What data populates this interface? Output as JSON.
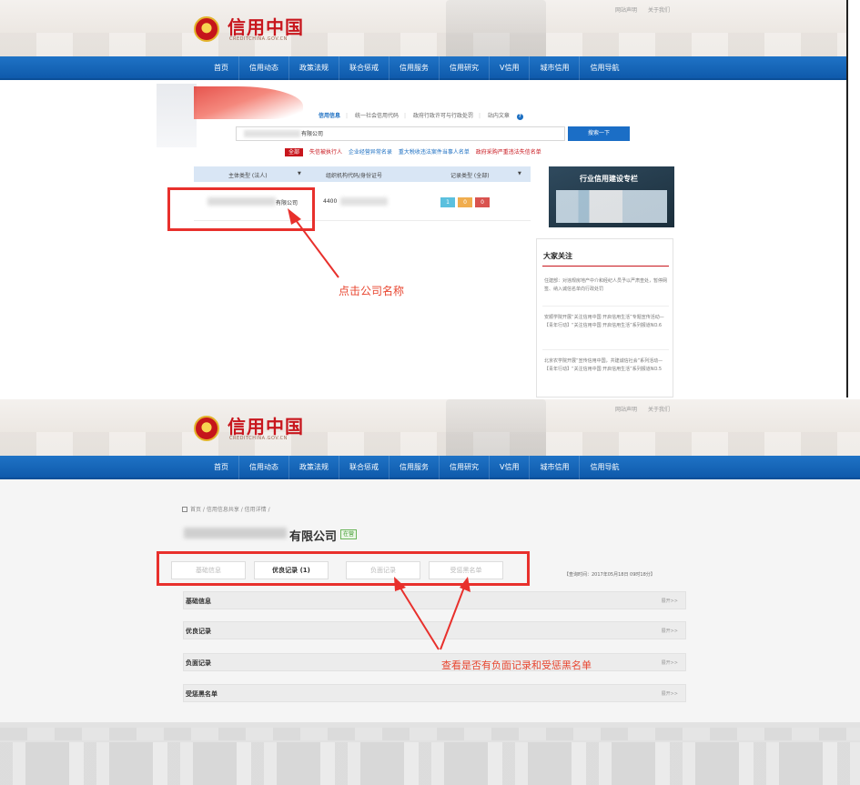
{
  "header": {
    "logo_title": "信用中国",
    "logo_subtitle": "CREDITCHINA.GOV.CN",
    "top_links": [
      "网站声明",
      "关于我们"
    ]
  },
  "nav": [
    "首页",
    "信用动态",
    "政策法规",
    "联合惩戒",
    "信用服务",
    "信用研究",
    "V信用",
    "城市信用",
    "信用导航"
  ],
  "screen1": {
    "search_tabs": [
      "信用信息",
      "统一社会信用代码",
      "政府行政许可与行政处罚",
      "站内文章"
    ],
    "search_value": "有限公司",
    "search_button": "搜索一下",
    "filters": [
      "全部",
      "失信被执行人",
      "企业经营异常名录",
      "重大税收违法案件当事人名单",
      "政府采购严重违法失信名单"
    ],
    "table_headers": [
      "主体类型 (法人)",
      "组织机构代码/身份证号",
      "记录类型 (全部)"
    ],
    "row": {
      "company": "有限公司",
      "code": "4400",
      "records": [
        {
          "value": "1",
          "color": "#5bc0de"
        },
        {
          "value": "0",
          "color": "#f0ad4e"
        },
        {
          "value": "0",
          "color": "#d9534f"
        }
      ]
    },
    "annotation": "点击公司名称",
    "promo_title": "行业信用建设专栏",
    "attention": {
      "title": "大家关注",
      "items": [
        "住建部：对违规房地产中介和经纪人员予以严肃查处，暂停网签、纳入诚信名单向行政处罚",
        "安顺学院开展“关注信用中国 开启信用生活”专题宣传活动—【青年行动】“关注信用中国 开启信用生活”系列报道NO.6",
        "北京农学院开展“宣传信用中国，共建诚信社会”系列活动—【青年行动】“关注信用中国 开启信用生活”系列报道NO.5"
      ]
    }
  },
  "screen2": {
    "breadcrumb": "首页 / 信用信息共享 / 信用详情 /",
    "company": "有限公司",
    "status_badge": "在营",
    "tabs": [
      "基础信息",
      "优良记录 (1)",
      "负面记录",
      "受惩黑名单"
    ],
    "query_time": "【查询时间：2017年05月18日 09时18分】",
    "sections": [
      "基础信息",
      "优良记录",
      "负面记录",
      "受惩黑名单"
    ],
    "expand_label": "展开>>",
    "annotation": "查看是否有负面记录和受惩黑名单"
  },
  "colors": {
    "nav_blue": "#1866b7",
    "brand_red": "#c8161d",
    "annotation_red": "#e8302c"
  }
}
